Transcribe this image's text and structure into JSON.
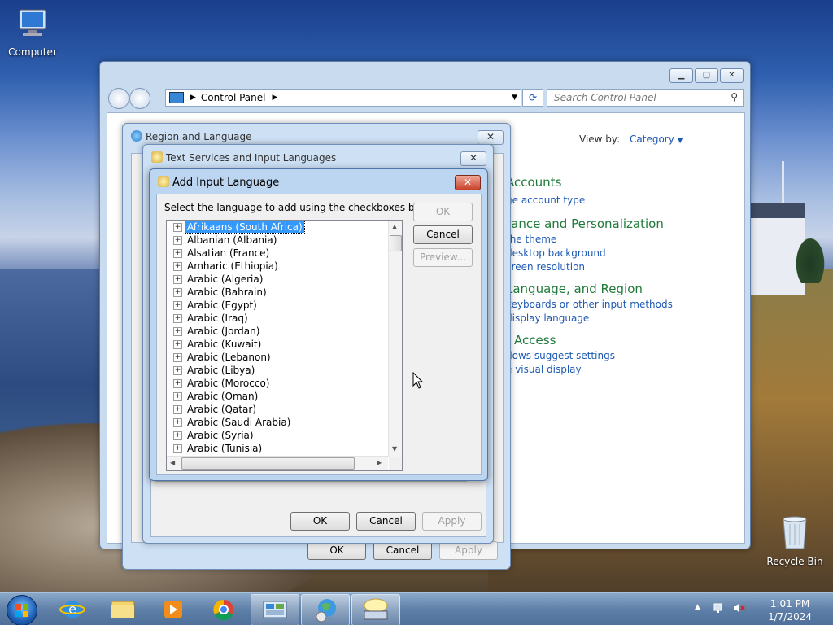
{
  "desktop": {
    "icons": [
      {
        "label": "Computer",
        "icon": "computer-icon"
      },
      {
        "label": "Recycle Bin",
        "icon": "recycle-bin-icon"
      }
    ]
  },
  "control_panel": {
    "breadcrumb": "Control Panel",
    "search_placeholder": "Search Control Panel",
    "view_by_label": "View by:",
    "view_by_value": "Category",
    "categories": [
      {
        "title": "Accounts",
        "links": [
          "ge account type"
        ]
      },
      {
        "title": "rance and Personalization",
        "links": [
          "the theme",
          "desktop background",
          "creen resolution"
        ]
      },
      {
        "title": "Language, and Region",
        "links": [
          "keyboards or other input methods",
          "display language"
        ]
      },
      {
        "title": "f Access",
        "links": [
          "dows suggest settings",
          "e visual display"
        ]
      }
    ]
  },
  "region_language": {
    "title": "Region and Language",
    "buttons": {
      "ok": "OK",
      "cancel": "Cancel",
      "apply": "Apply"
    }
  },
  "text_services": {
    "title": "Text Services and Input Languages",
    "buttons": {
      "ok": "OK",
      "cancel": "Cancel",
      "apply": "Apply"
    }
  },
  "add_input_language": {
    "title": "Add Input Language",
    "instruction": "Select the language to add using the checkboxes below.",
    "buttons": {
      "ok": "OK",
      "cancel": "Cancel",
      "preview": "Preview..."
    },
    "selected_index": 0,
    "languages": [
      "Afrikaans (South Africa)",
      "Albanian (Albania)",
      "Alsatian (France)",
      "Amharic (Ethiopia)",
      "Arabic (Algeria)",
      "Arabic (Bahrain)",
      "Arabic (Egypt)",
      "Arabic (Iraq)",
      "Arabic (Jordan)",
      "Arabic (Kuwait)",
      "Arabic (Lebanon)",
      "Arabic (Libya)",
      "Arabic (Morocco)",
      "Arabic (Oman)",
      "Arabic (Qatar)",
      "Arabic (Saudi Arabia)",
      "Arabic (Syria)",
      "Arabic (Tunisia)"
    ]
  },
  "taskbar": {
    "items": [
      "internet-explorer-icon",
      "windows-explorer-icon",
      "media-player-icon",
      "chrome-icon",
      "control-panel-icon",
      "region-language-icon",
      "input-language-icon"
    ],
    "time": "1:01 PM",
    "date": "1/7/2024"
  }
}
